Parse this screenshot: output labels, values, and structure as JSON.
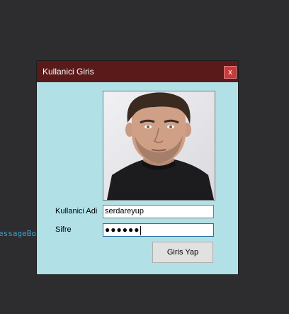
{
  "background": {
    "code_fragment": "essageBo"
  },
  "window": {
    "title": "Kullanici Giris",
    "close_label": "x",
    "colors": {
      "titlebar": "#5a1a1a",
      "body": "#b2e0e7",
      "close": "#c93b3b"
    }
  },
  "photo": {
    "icon": "user-portrait-photo"
  },
  "form": {
    "username_label": "Kullanici Adi",
    "username_value": "serdareyup",
    "password_label": "Sifre",
    "password_value": "●●●●●●",
    "submit_label": "Giris Yap"
  }
}
